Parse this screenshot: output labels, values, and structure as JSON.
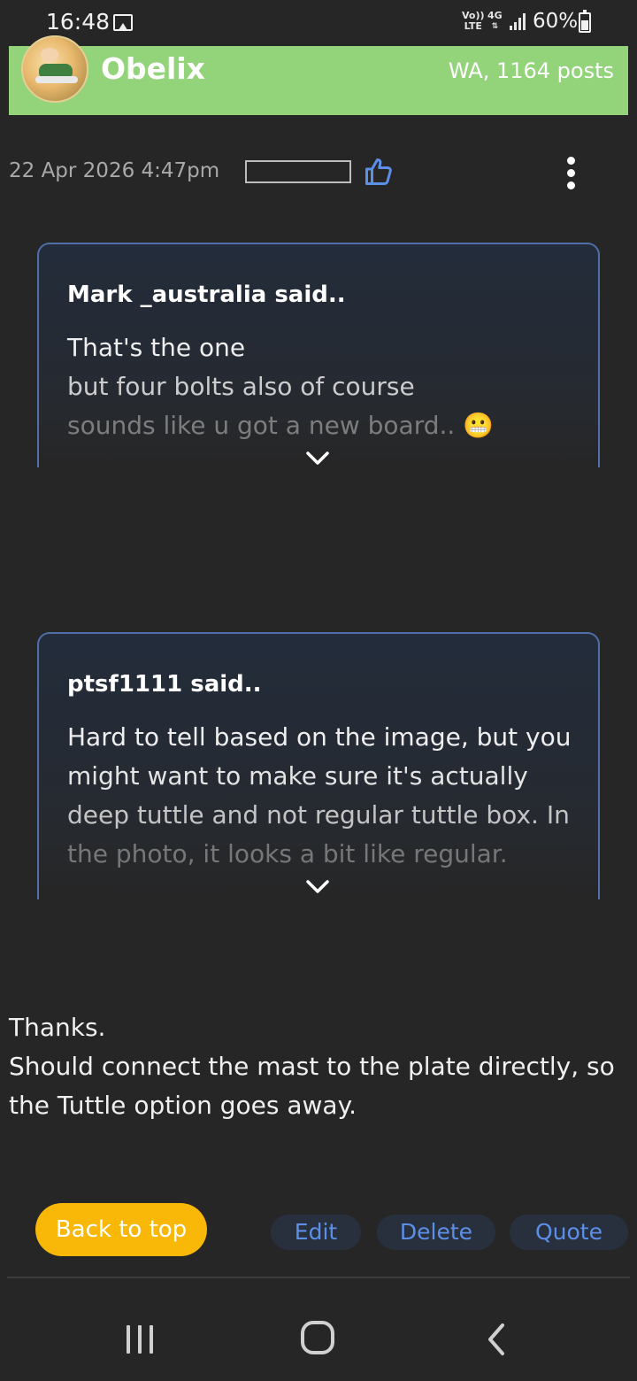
{
  "status_bar": {
    "time": "16:48",
    "volte_label": "Vo)) LTE",
    "volte_top": "Vo))",
    "volte_bottom": "LTE",
    "network_label": "4G",
    "battery_percent": "60%",
    "icons": [
      "gallery-icon",
      "volte-icon",
      "network-4g-icon",
      "signal-icon",
      "battery-icon"
    ]
  },
  "user_header": {
    "name": "Obelix",
    "meta": "WA, 1164 posts",
    "background_color": "#93d47b"
  },
  "post": {
    "date": "22 Apr 2026 4:47pm",
    "icons": [
      "like-icon",
      "more-options-icon"
    ],
    "accent_color": "#5c8fe8",
    "quotes": [
      {
        "author": "Mark _australia said..",
        "lines": [
          "That's the one",
          "but four bolts also of course",
          "sounds like u got a new board.. 😬"
        ]
      },
      {
        "author": "ptsf1111 said..",
        "lines": [
          "Hard to tell based on the image, but you",
          "might want to make sure it's actually",
          "deep tuttle and not regular tuttle box. In",
          "the photo, it looks a bit like regular."
        ]
      }
    ],
    "reply_lines": [
      "Thanks.",
      "Should connect the mast to the plate directly, so",
      "the Tuttle option goes away."
    ]
  },
  "actions": {
    "back_to_top": "Back to top",
    "edit": "Edit",
    "delete": "Delete",
    "quote": "Quote",
    "back_to_top_color": "#f9b808"
  },
  "nav_bar": {
    "icons": [
      "recent-apps-icon",
      "home-icon",
      "back-icon"
    ]
  }
}
